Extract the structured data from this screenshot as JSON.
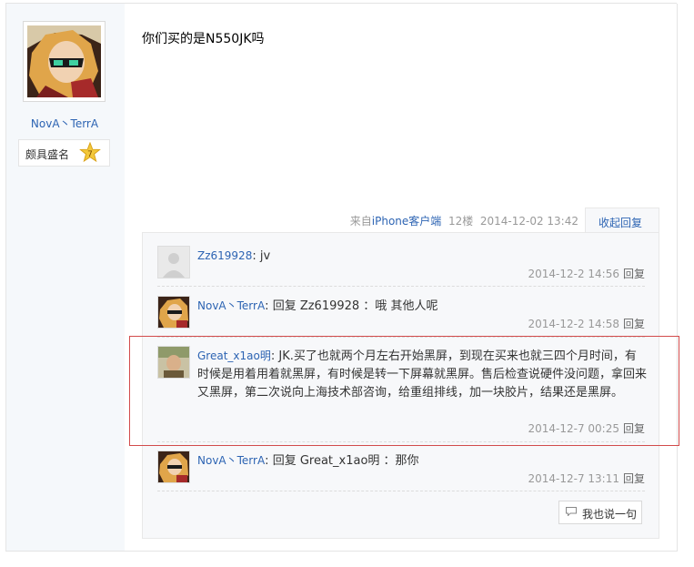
{
  "author": {
    "username": "NovA丶TerrA",
    "badge_label": "颇具盛名",
    "badge_level": "7"
  },
  "post": {
    "content": "你们买的是N550JK吗",
    "source_prefix": "来自",
    "source_client": "iPhone客户端",
    "floor": "12楼",
    "datetime": "2014-12-02 13:42",
    "collapse_label": "收起回复"
  },
  "replies": [
    {
      "name": "Zz619928",
      "sep": ": ",
      "text": "jv",
      "time": "2014-12-2 14:56",
      "reply_label": "回复"
    },
    {
      "name": "NovA丶TerrA",
      "sep": ": ",
      "text": "回复 Zz619928 ：哦 其他人呢",
      "time": "2014-12-2 14:58",
      "reply_label": "回复"
    },
    {
      "name": "Great_x1ao明",
      "sep": ": ",
      "text": "JK.买了也就两个月左右开始黑屏，到现在买来也就三四个月时间，有时候是用着用着就黑屏，有时候是转一下屏幕就黑屏。售后检查说硬件没问题，拿回来又黑屏，第二次说向上海技术部咨询，给重组排线，加一块胶片，结果还是黑屏。",
      "time": "2014-12-7 00:25",
      "reply_label": "回复"
    },
    {
      "name": "NovA丶TerrA",
      "sep": ": ",
      "text": "回复 Great_x1ao明 ：那你",
      "time": "2014-12-7 13:11",
      "reply_label": "回复"
    }
  ],
  "actions": {
    "say_label": "我也说一句"
  },
  "colors": {
    "link": "#2d64b3",
    "highlight": "#d24b4b",
    "panel_bg": "#f7f8fa"
  }
}
